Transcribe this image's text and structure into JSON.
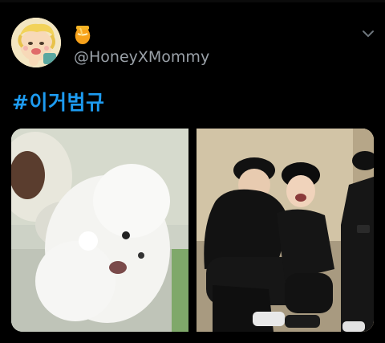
{
  "tweet": {
    "author_handle": "@HoneyXMommy",
    "display_name_icon": "honey-pot-icon",
    "hashtag": "#이거범규",
    "menu_icon": "chevron-down-icon"
  },
  "colors": {
    "background": "#000000",
    "hashtag": "#1d9bf0",
    "handle": "#9aa1a8"
  },
  "media": {
    "count": 2,
    "items": [
      {
        "kind": "photo",
        "subject": "white-dog"
      },
      {
        "kind": "photo",
        "subject": "people-seated"
      }
    ]
  }
}
